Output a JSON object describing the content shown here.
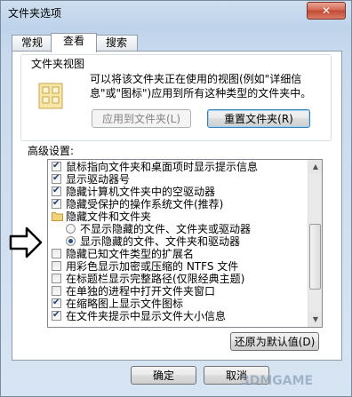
{
  "window": {
    "title": "文件夹选项",
    "close_glyph": "✕"
  },
  "tabs": [
    {
      "label": "常规"
    },
    {
      "label": "查看"
    },
    {
      "label": "搜索"
    }
  ],
  "folder_view": {
    "legend": "文件夹视图",
    "description": "可以将该文件夹正在使用的视图(例如\"详细信息\"或\"图标\")应用到所有这种类型的文件夹中。",
    "apply_button": "应用到文件夹(L)",
    "reset_button": "重置文件夹(R)"
  },
  "advanced": {
    "label": "高级设置:",
    "items": [
      {
        "type": "checkbox",
        "checked": true,
        "label": "鼠标指向文件夹和桌面项时显示提示信息"
      },
      {
        "type": "checkbox",
        "checked": true,
        "label": "显示驱动器号"
      },
      {
        "type": "checkbox",
        "checked": true,
        "label": "隐藏计算机文件夹中的空驱动器"
      },
      {
        "type": "checkbox",
        "checked": true,
        "label": "隐藏受保护的操作系统文件(推荐)"
      },
      {
        "type": "folder",
        "label": "隐藏文件和文件夹"
      },
      {
        "type": "radio",
        "checked": false,
        "label": "不显示隐藏的文件、文件夹或驱动器"
      },
      {
        "type": "radio",
        "checked": true,
        "label": "显示隐藏的文件、文件夹和驱动器"
      },
      {
        "type": "checkbox",
        "checked": false,
        "label": "隐藏已知文件类型的扩展名"
      },
      {
        "type": "checkbox",
        "checked": false,
        "label": "用彩色显示加密或压缩的 NTFS 文件"
      },
      {
        "type": "checkbox",
        "checked": false,
        "label": "在标题栏显示完整路径(仅限经典主题)"
      },
      {
        "type": "checkbox",
        "checked": false,
        "label": "在单独的进程中打开文件夹窗口"
      },
      {
        "type": "checkbox",
        "checked": true,
        "label": "在缩略图上显示文件图标"
      },
      {
        "type": "checkbox",
        "checked": true,
        "label": "在文件夹提示中显示文件大小信息"
      }
    ]
  },
  "restore_button": "还原为默认值(D)",
  "ok_button": "确定",
  "cancel_button": "取消",
  "watermark": "3DMGAME"
}
